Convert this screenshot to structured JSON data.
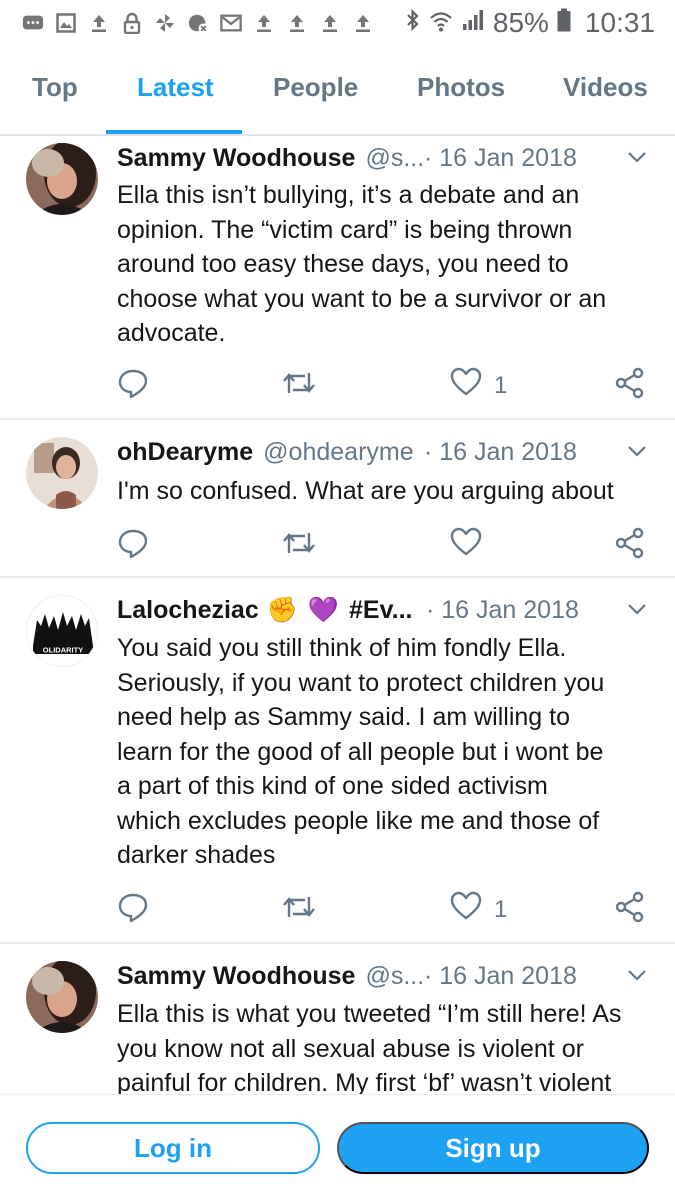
{
  "status_bar": {
    "battery": "85%",
    "time": "10:31",
    "icons": [
      "chat-icon",
      "image-icon",
      "upload-icon",
      "lock-icon",
      "pinwheel-icon",
      "alarm-off-icon",
      "mail-icon",
      "upload-icon",
      "upload-icon",
      "upload-icon",
      "upload-icon",
      "bluetooth-icon",
      "wifi-icon",
      "signal-icon",
      "battery-icon"
    ]
  },
  "tabs": [
    {
      "label": "Top",
      "active": false
    },
    {
      "label": "Latest",
      "active": true
    },
    {
      "label": "People",
      "active": false
    },
    {
      "label": "Photos",
      "active": false
    },
    {
      "label": "Videos",
      "active": false
    }
  ],
  "tweets": [
    {
      "name": "Sammy Woodhouse",
      "handle": "@s...",
      "date": "· 16 Jan 2018",
      "text": "Ella this isn’t bullying, it’s a debate and an\nopinion. The “victim card” is being thrown\naround too easy these days, you need to\nchoose what you want to be a survivor or an\nadvocate.",
      "likes": "1"
    },
    {
      "name": "ohDearyme",
      "handle": "@ohdearyme",
      "date": "· 16 Jan 2018",
      "text": "I'm so confused. What are you arguing about",
      "likes": ""
    },
    {
      "name": "Lalocheziac",
      "name_emoji": "✊",
      "name_emoji2": "💜",
      "handle": "#Ev...",
      "date": "· 16 Jan 2018",
      "avatar_text": "OLIDARITY",
      "text": "You said you still think of him fondly Ella.\nSeriously, if you want to protect children you\nneed help as Sammy said. I am willing to\nlearn for the good of all people but i wont be\na part of this kind of one sided  activism\nwhich excludes people like me and those of\ndarker shades",
      "likes": "1"
    },
    {
      "name": "Sammy Woodhouse",
      "handle": "@s...",
      "date": "· 16 Jan 2018",
      "text": "Ella this is what you tweeted “I’m still here! As\nyou know not all sexual abuse is violent or\npainful for children. My first ‘bf’ wasn’t violent",
      "likes": ""
    }
  ],
  "bottom": {
    "login": "Log in",
    "signup": "Sign up"
  },
  "colors": {
    "accent": "#1da1f2",
    "secondary_text": "#657786",
    "divider": "#e6ecf0"
  }
}
